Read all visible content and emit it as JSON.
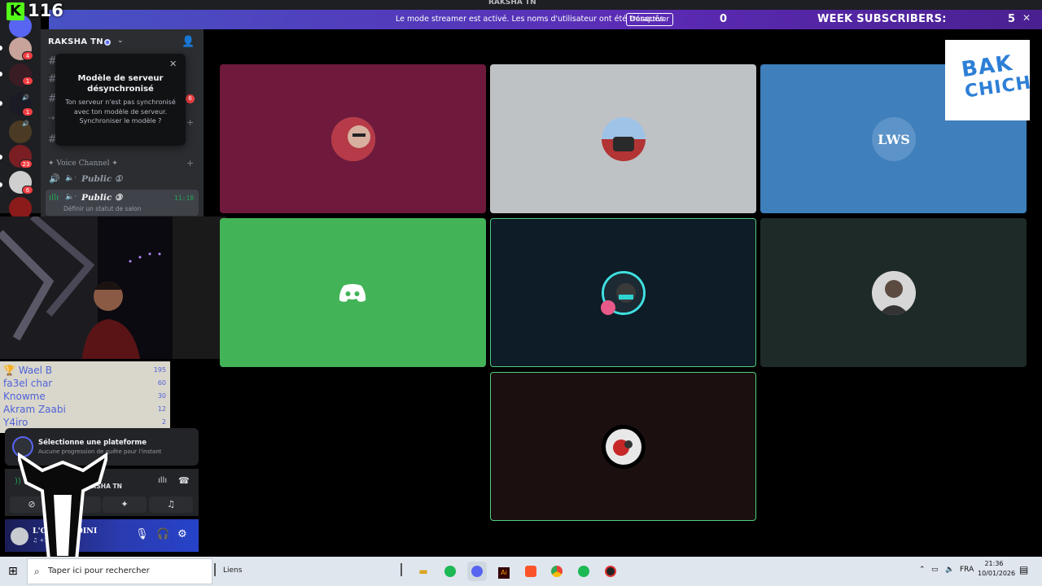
{
  "window": {
    "title": "RAKSHA TN"
  },
  "streamer_bar": {
    "message": "Le mode streamer est activé. Les noms d'utilisateur ont été tronqués.",
    "disable_label": "Désactiver",
    "counter": "0",
    "week_label": "WEEK SUBSCRIBERS:",
    "week_value": "5"
  },
  "overlay": {
    "kick_letter": "K",
    "kick_count": "116"
  },
  "server_rail": {
    "badges": [
      "4",
      "1",
      "1",
      "6",
      "23",
      "6",
      "434"
    ]
  },
  "channels": {
    "server_name": "RAKSHA TN",
    "badge": "6",
    "category": "✦ Voice Channel ✦",
    "voice_channels": [
      {
        "label": "Public",
        "count": "①"
      },
      {
        "label": "Public",
        "count": "③",
        "time": "11:18"
      }
    ],
    "status_hint": "Définir un statut de salon"
  },
  "popup": {
    "title": "Modèle de serveur désynchronisé",
    "body": "Ton serveur n'est pas synchronisé avec ton modèle de serveur. Synchroniser le modèle ?"
  },
  "leaderboard": [
    {
      "name": "Wael B",
      "value": "195"
    },
    {
      "name": "fa3el char",
      "value": "60"
    },
    {
      "name": "Knowme",
      "value": "30"
    },
    {
      "name": "Akram Zaabi",
      "value": "12"
    },
    {
      "name": "Y4iro",
      "value": "2"
    }
  ],
  "quest": {
    "title": "Sélectionne une plateforme",
    "subtitle": "Aucune progression de quête pour l'instant"
  },
  "voice_panel": {
    "server": "RAKSHA TN"
  },
  "user_panel": {
    "name": "L'GR MALDINI",
    "status": "+1"
  },
  "tiles": [
    {
      "bg": "#6f1a3c",
      "border": "none"
    },
    {
      "bg": "#bfc2c5",
      "border": "none"
    },
    {
      "bg": "#3f7fbb",
      "border": "none"
    },
    {
      "bg": "#43b358",
      "border": "none"
    },
    {
      "bg": "#0d1c26",
      "border": "#4fcf7d"
    },
    {
      "bg": "#1e2a27",
      "border": "none"
    },
    {
      "bg": "#1b0f0f",
      "border": "#4fcf7d"
    }
  ],
  "bak_logo": {
    "line1": "BAK",
    "line2": "CHICH"
  },
  "taskbar": {
    "search_placeholder": "Taper ici pour rechercher",
    "links_label": "Liens",
    "lang": "FRA",
    "time": "21:36",
    "date": "10/01/2026"
  }
}
